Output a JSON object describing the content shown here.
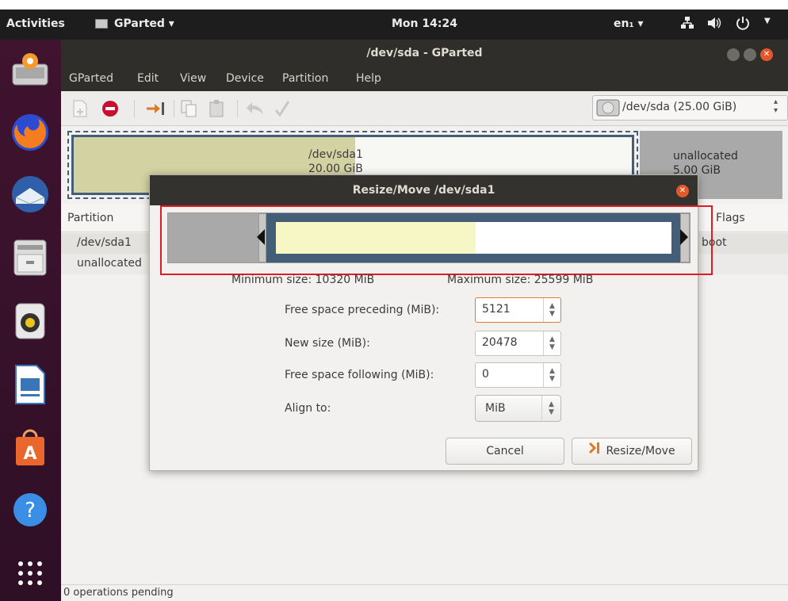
{
  "panel": {
    "activities": "Activities",
    "app_menu": "GParted ▾",
    "clock": "Mon 14:24",
    "input_source": "en₁ ▾"
  },
  "window": {
    "title": "/dev/sda - GParted",
    "menu": [
      "GParted",
      "Edit",
      "View",
      "Device",
      "Partition",
      "Help"
    ],
    "device_selector": "/dev/sda  (25.00 GiB)"
  },
  "disk_map": {
    "partition": {
      "name": "/dev/sda1",
      "size": "20.00 GiB"
    },
    "unallocated": {
      "name": "unallocated",
      "size": "5.00 GiB"
    }
  },
  "table": {
    "headers": {
      "partition": "Partition",
      "flags": "Flags"
    },
    "rows": [
      {
        "partition": "/dev/sda1",
        "flags": "boot"
      },
      {
        "partition": "unallocated",
        "flags": ""
      }
    ]
  },
  "dialog": {
    "title": "Resize/Move /dev/sda1",
    "min_size": "Minimum size: 10320 MiB",
    "max_size": "Maximum size: 25599 MiB",
    "fields": {
      "preceding_label": "Free space preceding (MiB):",
      "preceding_value": "5121",
      "new_size_label": "New size (MiB):",
      "new_size_value": "20478",
      "following_label": "Free space following (MiB):",
      "following_value": "0",
      "align_label": "Align to:",
      "align_value": "MiB"
    },
    "cancel": "Cancel",
    "resize_move": "Resize/Move"
  },
  "status": "0 operations pending",
  "colors": {
    "used_space": "#f6f7c4",
    "partition_border": "#445e77",
    "highlight": "#e01b24",
    "panel": "#1d1d1d"
  }
}
